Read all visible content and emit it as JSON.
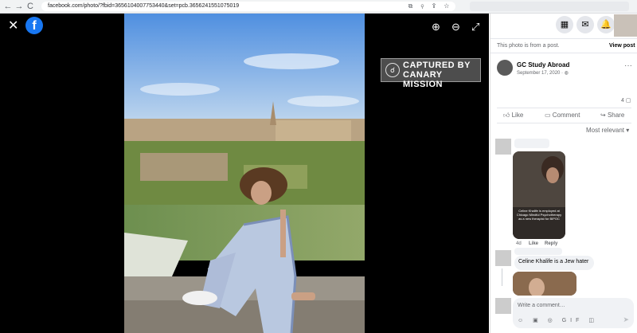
{
  "browser": {
    "back": "←",
    "forward": "→",
    "reload": "C",
    "url": "facebook.com/photo/?fbid=3656104007753440&set=pcb.3656241551075019",
    "url_icons": "⧉ ⚲ ⇪ ☆"
  },
  "viewer": {
    "close": "✕",
    "logo": "f",
    "zoom_in": "⊕",
    "zoom_out": "⊖",
    "fullscreen": "⤢",
    "watermark_icon": "☌",
    "watermark_line1": "CAPTURED BY",
    "watermark_line2": "CANARY MISSION"
  },
  "panel": {
    "grid": "▦",
    "messenger": "✉",
    "bell": "🔔",
    "info_text": "This photo is from a post.",
    "view_post": "View post",
    "page_name": "GC Study Abroad",
    "post_date": "September 17, 2020 · ",
    "more": "···",
    "reaction_count": "4",
    "like": "Like",
    "comment": "Comment",
    "share": "Share",
    "sort": "Most relevant ▾",
    "comment_card_caption": "Celine Khalife is employed at Chicago Mindful Psychotherapy as a new therapist for BIPOC",
    "comment_age": "4d",
    "comment_like": "Like",
    "comment_reply": "Reply",
    "comment2_text": "Celine Khalife is a Jew hater",
    "composer_placeholder": "Write a comment…",
    "composer_icons": "☺ ▣ ◎ GIF ◫",
    "send": "➤"
  }
}
